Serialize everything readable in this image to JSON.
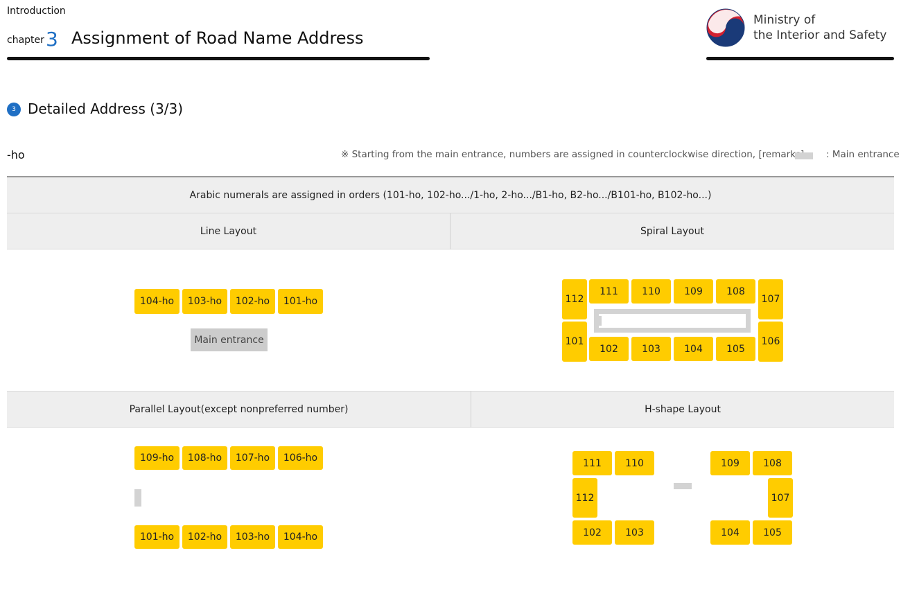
{
  "header": {
    "breadcrumb": "Introduction",
    "chapter_word": "chapter",
    "chapter_number": "3",
    "chapter_title": "Assignment of Road Name Address",
    "ministry_line1": "Ministry of",
    "ministry_line2": "the Interior and Safety"
  },
  "section": {
    "number": "3",
    "title": "Detailed Address (3/3)"
  },
  "subheading": "-ho",
  "note": "※ Starting from the main entrance, numbers are assigned in counterclockwise direction, [remarks]",
  "legend_label": ": Main entrance",
  "table": {
    "header": "Arabic numerals are assigned in orders (101-ho, 102-ho.../1-ho, 2-ho.../B1-ho, B2-ho.../B101-ho, B102-ho...)",
    "line_layout": "Line Layout",
    "spiral_layout": "Spiral Layout",
    "parallel_layout": "Parallel Layout(except nonpreferred number)",
    "h_shape_layout": "H-shape Layout"
  },
  "line_units": [
    "104-ho",
    "103-ho",
    "102-ho",
    "101-ho"
  ],
  "line_entrance": "Main entrance",
  "spiral": {
    "top": [
      "111",
      "110",
      "109",
      "108"
    ],
    "bottom": [
      "102",
      "103",
      "104",
      "105"
    ],
    "left_top": "112",
    "left_bottom": "101",
    "right_top": "107",
    "right_bottom": "106"
  },
  "parallel": {
    "top": [
      "109-ho",
      "108-ho",
      "107-ho",
      "106-ho"
    ],
    "bottom": [
      "101-ho",
      "102-ho",
      "103-ho",
      "104-ho"
    ]
  },
  "h_shape": {
    "left_top": [
      "111",
      "110"
    ],
    "left_mid": "112",
    "left_bottom": [
      "102",
      "103"
    ],
    "right_top": [
      "109",
      "108"
    ],
    "right_mid": "107",
    "right_bottom": [
      "104",
      "105"
    ]
  },
  "colors": {
    "unit": "#ffcc00",
    "accent": "#1f6fc4",
    "entrance": "#d3d3d3"
  }
}
